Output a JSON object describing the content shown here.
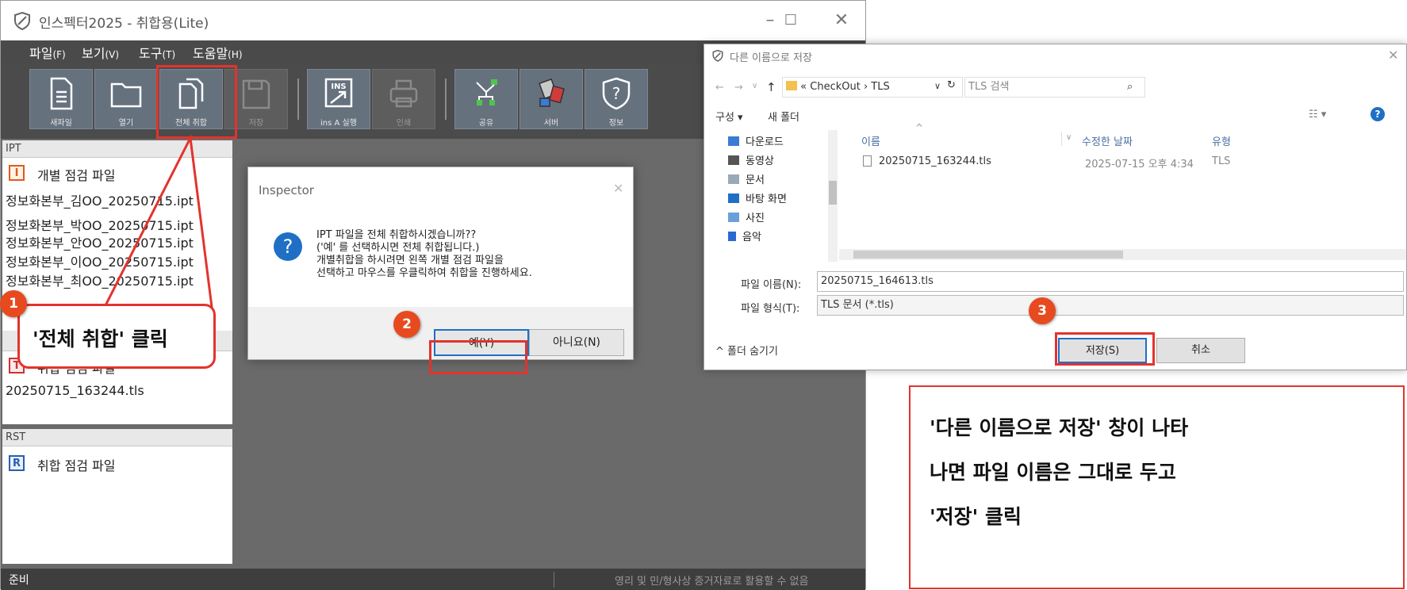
{
  "app": {
    "title": "인스펙터2025 - 취합용(Lite)",
    "menu": [
      {
        "label": "파일",
        "key": "(F)"
      },
      {
        "label": "보기",
        "key": "(V)"
      },
      {
        "label": "도구",
        "key": "(T)"
      },
      {
        "label": "도움말",
        "key": "(H)"
      }
    ],
    "toolbar": [
      "새파일",
      "열기",
      "전체 취합",
      "저장",
      "ins A 실행",
      "인쇄",
      "공유",
      "서버",
      "정보"
    ],
    "ipt_panel": {
      "header": "IPT",
      "title": "개별 점검 파일",
      "files": [
        "정보화본부_김OO_20250715.ipt",
        "정보화본부_박OO_20250715.ipt",
        "정보화본부_안OO_20250715.ipt",
        "정보화본부_이OO_20250715.ipt",
        "정보화본부_최OO_20250715.ipt"
      ]
    },
    "tls_panel": {
      "title": "취합 점검 파일",
      "files": [
        "20250715_163244.tls"
      ]
    },
    "rst_panel": {
      "header": "RST",
      "title": "취합 점검 파일"
    },
    "status_left": "준비",
    "status_right": "영리 및 민/형사상 증거자료로 활용할 수 없음"
  },
  "dialog": {
    "title": "Inspector",
    "lines": [
      "IPT 파일을 전체 취합하시겠습니까??",
      "('예' 를 선택하시면 전체 취합됩니다.)",
      "개별취합을 하시려면 왼쪽 개별 점검 파일을",
      "선택하고 마우스를 우클릭하여 취합을 진행하세요."
    ],
    "yes": "예(Y)",
    "no": "아니요(N)"
  },
  "saveas": {
    "title": "다른 이름으로 저장",
    "path": [
      "«",
      "CheckOut",
      "›",
      "TLS"
    ],
    "search_placeholder": "TLS 검색",
    "organize": "구성 ▾",
    "new_folder": "새 폴더",
    "nav": [
      "다운로드",
      "동영상",
      "문서",
      "바탕 화면",
      "사진",
      "음악"
    ],
    "columns": {
      "name": "이름",
      "date": "수정한 날짜",
      "type": "유형"
    },
    "rows": [
      {
        "name": "20250715_163244.tls",
        "date": "2025-07-15 오후 4:34",
        "type": "TLS"
      }
    ],
    "filename_label": "파일 이름(N):",
    "filename": "20250715_164613.tls",
    "filetype_label": "파일 형식(T):",
    "filetype": "TLS 문서 (*.tls)",
    "hide_folders": "^ 폴더 숨기기",
    "save": "저장(S)",
    "cancel": "취소"
  },
  "annotations": {
    "n1": "1",
    "n2": "2",
    "n3": "3",
    "callout1": "'전체 취합' 클릭",
    "callout2": [
      "'다른 이름으로 저장'  창이 나타",
      "나면 파일 이름은 그대로 두고",
      "'저장' 클릭"
    ],
    "accent": "#e3332d"
  }
}
